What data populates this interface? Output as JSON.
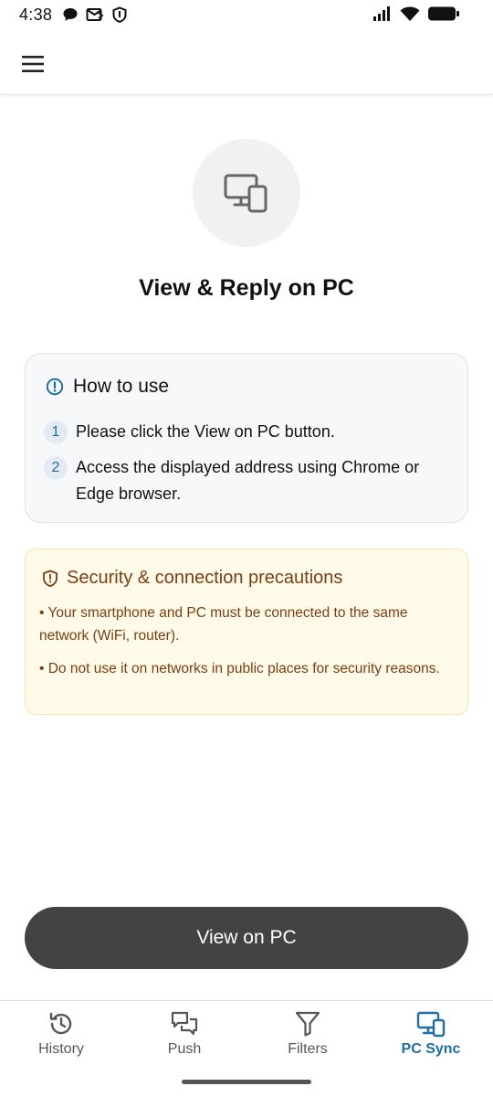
{
  "status_bar": {
    "time": "4:38",
    "left_icons": [
      "chat-bubble-icon",
      "mail-icon",
      "shield-icon"
    ],
    "right_icons": [
      "signal-icon",
      "wifi-icon",
      "battery-icon"
    ]
  },
  "app_bar": {
    "menu_icon": "hamburger-menu-icon"
  },
  "hero": {
    "icon": "devices-icon",
    "title": "View & Reply on PC"
  },
  "how_to_use": {
    "title": "How to use",
    "steps": [
      {
        "number": "1",
        "text": "Please click the View on PC button."
      },
      {
        "number": "2",
        "text": "Access the displayed address using Chrome or Edge browser."
      }
    ]
  },
  "security": {
    "title": "Security & connection precautions",
    "items": [
      "• Your smartphone and PC must be connected to the same network (WiFi, router).",
      "• Do not use it on networks in public places for security reasons."
    ]
  },
  "primary_button": {
    "label": "View on PC"
  },
  "bottom_nav": {
    "items": [
      {
        "label": "History",
        "icon": "history-icon",
        "active": false
      },
      {
        "label": "Push",
        "icon": "push-icon",
        "active": false
      },
      {
        "label": "Filters",
        "icon": "filter-icon",
        "active": false
      },
      {
        "label": "PC Sync",
        "icon": "pc-sync-icon",
        "active": true
      }
    ]
  },
  "colors": {
    "accent": "#1d6fa5",
    "button_bg": "#434343",
    "warning_bg": "#fffbe8",
    "warning_text": "#7a3e16",
    "info_bg": "#f7f8fa"
  }
}
